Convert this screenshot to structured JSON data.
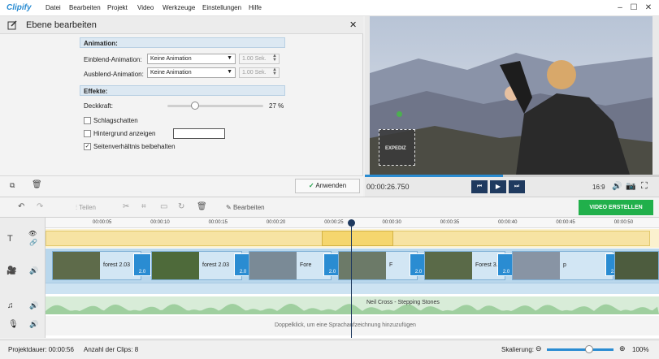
{
  "app": {
    "logo": "Clipify",
    "menu": [
      "Datei",
      "Bearbeiten",
      "Projekt",
      "Video",
      "Werkzeuge",
      "Einstellungen",
      "Hilfe"
    ]
  },
  "panel": {
    "title": "Ebene bearbeiten",
    "animation_header": "Animation:",
    "in_label": "Einblend-Animation:",
    "in_value": "Keine Animation",
    "in_duration": "1.00 Sek.",
    "out_label": "Ausblend-Animation:",
    "out_value": "Keine Animation",
    "out_duration": "1.00 Sek.",
    "effects_header": "Effekte:",
    "opacity_label": "Deckkraft:",
    "opacity_value": "27 %",
    "opacity_level": 0.27,
    "shadow_label": "Schlagschatten",
    "background_label": "Hintergrund anzeigen",
    "aspect_label": "Seitenverhältnis beibehalten",
    "aspect_checked": true,
    "apply_label": "Anwenden"
  },
  "preview": {
    "logo_text": "EXPEDIZ",
    "timecode": "00:00:26.750",
    "ratio": "16:9",
    "progress": 0.47
  },
  "toolbar": {
    "split_label": "Teilen",
    "edit_label": "Bearbeiten",
    "export_label": "VIDEO ERSTELLEN"
  },
  "timeline": {
    "ticks": [
      "00:00:05",
      "00:00:10",
      "00:00:15",
      "00:00:20",
      "00:00:25",
      "00:00:30",
      "00:00:35",
      "00:00:40",
      "00:00:45",
      "00:00:50"
    ],
    "clips": [
      {
        "label": "forest 2.03"
      },
      {
        "label": "forest 2.03"
      },
      {
        "label": "Fore"
      },
      {
        "label": "F"
      },
      {
        "label": "Forest 3.03"
      },
      {
        "label": "p"
      }
    ],
    "transition_label": "2.0",
    "audio_label": "Neil Cross - Stepping Stones",
    "voice_hint": "Doppelklick, um eine Sprachaufzeichnung hinzuzufügen"
  },
  "status": {
    "duration": "Projektdauer:  00:00:56",
    "clip_count": "Anzahl der Clips: 8",
    "zoom_label": "Skalierung:",
    "zoom_value": "100%"
  },
  "colors": {
    "accent": "#2a8cd2",
    "export": "#21b04b",
    "title_track": "#f7e3a3",
    "video_track": "#b9d7ec"
  }
}
